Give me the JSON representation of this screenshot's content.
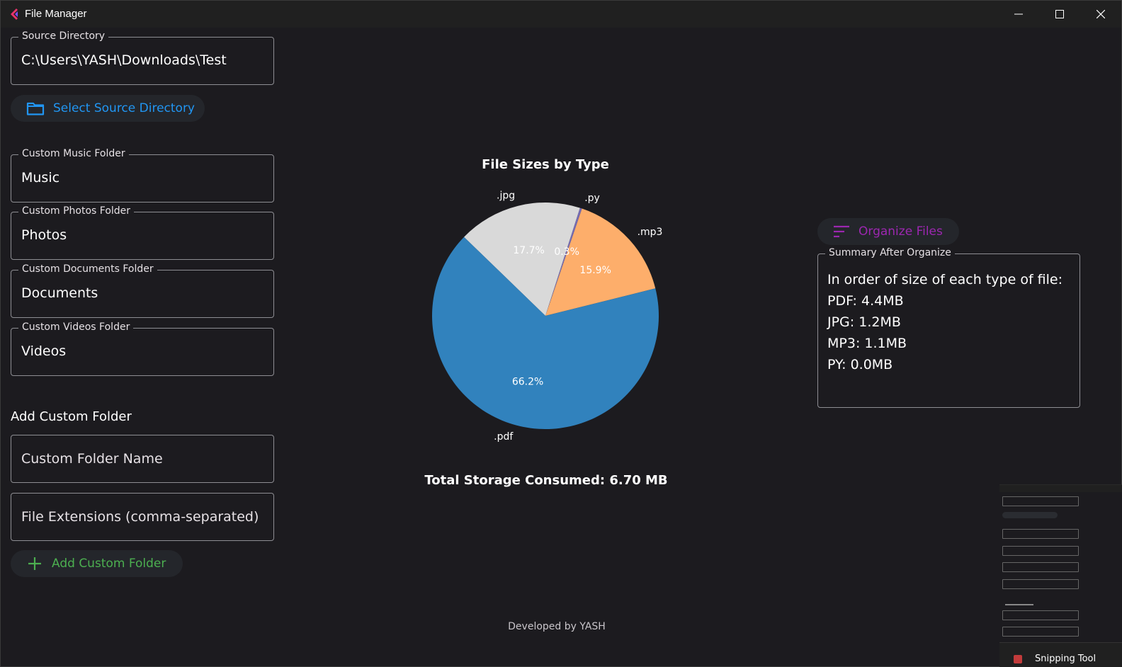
{
  "window": {
    "title": "File Manager"
  },
  "left_panel": {
    "source_directory": {
      "label": "Source Directory",
      "value": "C:\\Users\\YASH\\Downloads\\Test"
    },
    "select_source_button": "Select Source Directory",
    "custom_music": {
      "label": "Custom Music Folder",
      "value": "Music"
    },
    "custom_photos": {
      "label": "Custom Photos Folder",
      "value": "Photos"
    },
    "custom_documents": {
      "label": "Custom Documents Folder",
      "value": "Documents"
    },
    "custom_videos": {
      "label": "Custom Videos Folder",
      "value": "Videos"
    },
    "add_custom_heading": "Add Custom Folder",
    "custom_folder_name_placeholder": "Custom Folder Name",
    "file_extensions_placeholder": "File Extensions (comma-separated)",
    "add_custom_button": "Add Custom Folder"
  },
  "chart_data": {
    "type": "pie",
    "title": "File Sizes by Type",
    "slices": [
      {
        "label": ".pdf",
        "percent": 66.2,
        "pct_text": "66.2%",
        "color": "#3182bd"
      },
      {
        "label": ".mp3",
        "percent": 15.9,
        "pct_text": "15.9%",
        "color": "#fdae6b"
      },
      {
        "label": ".py",
        "percent": 0.3,
        "pct_text": "0.3%",
        "color": "#756bb1"
      },
      {
        "label": ".jpg",
        "percent": 17.7,
        "pct_text": "17.7%",
        "color": "#d9d9d9"
      }
    ]
  },
  "total_storage": "Total Storage Consumed: 6.70 MB",
  "right_panel": {
    "organize_button": "Organize Files",
    "summary": {
      "label": "Summary After Organize",
      "lines": [
        "In order of size of each type of file:",
        "PDF: 4.4MB",
        "JPG: 1.2MB",
        "MP3: 1.1MB",
        "PY: 0.0MB"
      ]
    }
  },
  "footer": "Developed by YASH",
  "snipping_notification": "Snipping Tool",
  "colors": {
    "background": "#1c1b1f",
    "select_accent": "#2196f3",
    "add_accent": "#4caf50",
    "organize_accent": "#9c27b0"
  }
}
